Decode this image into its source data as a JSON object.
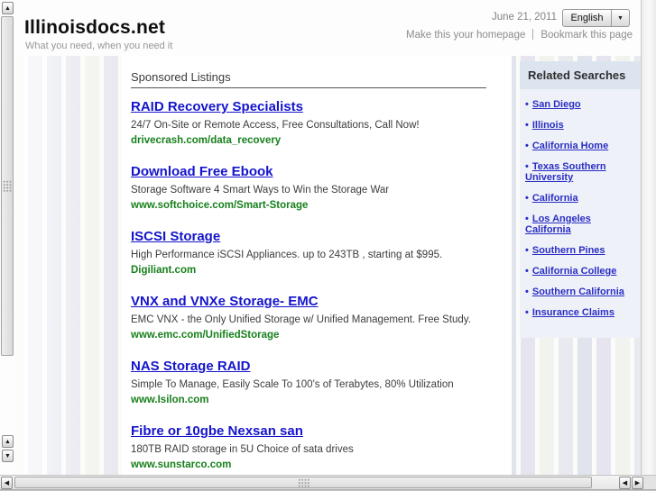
{
  "header": {
    "site_title": "Illinoisdocs.net",
    "tagline": "What you need, when you need it",
    "date": "June 21, 2011",
    "language": "English",
    "make_homepage": "Make this your homepage",
    "bookmark": "Bookmark this page"
  },
  "sponsored": {
    "heading": "Sponsored Listings",
    "listings": [
      {
        "title": "RAID Recovery Specialists",
        "description": "24/7 On-Site or Remote Access, Free Consultations, Call Now!",
        "display_url": "drivecrash.com/data_recovery"
      },
      {
        "title": "Download Free Ebook",
        "description": "Storage Software 4 Smart Ways to Win the Storage War",
        "display_url": "www.softchoice.com/Smart-Storage"
      },
      {
        "title": "ISCSI Storage",
        "description": "High Performance iSCSI Appliances. up to 243TB , starting at $995.",
        "display_url": "Digiliant.com"
      },
      {
        "title": "VNX and VNXe Storage- EMC",
        "description": "EMC VNX - the Only Unified Storage w/ Unified Management. Free Study.",
        "display_url": "www.emc.com/UnifiedStorage"
      },
      {
        "title": "NAS Storage RAID",
        "description": "Simple To Manage, Easily Scale To 100's of Terabytes, 80% Utilization",
        "display_url": "www.Isilon.com"
      },
      {
        "title": "Fibre or 10gbe Nexsan san",
        "description": "180TB RAID storage in 5U Choice of sata drives",
        "display_url": "www.sunstarco.com"
      }
    ]
  },
  "related": {
    "heading": "Related Searches",
    "bullet": "•",
    "links": [
      "San Diego",
      "Illinois",
      "California Home",
      "Texas Southern University",
      "California",
      "Los Angeles California",
      "Southern Pines",
      "California College",
      "Southern California",
      "Insurance Claims"
    ]
  },
  "icons": {
    "chevron_down": "▼",
    "scroll_up": "▲",
    "scroll_down": "▼",
    "scroll_left": "◀",
    "scroll_right": "▶"
  },
  "colors": {
    "listing_title_link": "#1414cc",
    "display_url_green": "#17801c",
    "sidebar_link_blue": "#2a2ec4",
    "sidebar_header_bg": "#dce4ef",
    "sidebar_body_bg": "#eef1f7"
  }
}
